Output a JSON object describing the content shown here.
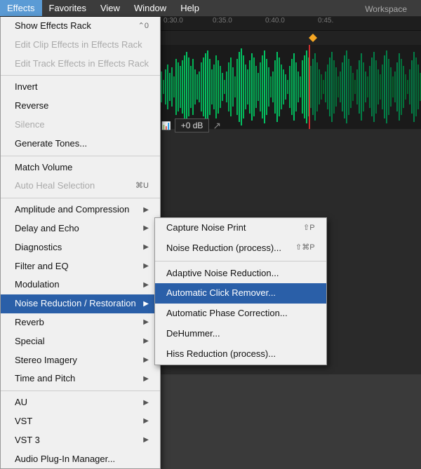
{
  "menubar": {
    "items": [
      {
        "label": "Effects",
        "active": true
      },
      {
        "label": "Favorites"
      },
      {
        "label": "View"
      },
      {
        "label": "Window"
      },
      {
        "label": "Help"
      }
    ]
  },
  "workspace_label": "Workspace",
  "main_menu": {
    "items": [
      {
        "label": "Show Effects Rack",
        "shortcut": "⌃0",
        "type": "normal"
      },
      {
        "label": "Edit Clip Effects in Effects Rack",
        "type": "disabled"
      },
      {
        "label": "Edit Track Effects in Effects Rack",
        "type": "disabled"
      },
      {
        "type": "separator"
      },
      {
        "label": "Invert",
        "type": "normal"
      },
      {
        "label": "Reverse",
        "type": "normal"
      },
      {
        "label": "Silence",
        "type": "disabled"
      },
      {
        "label": "Generate Tones...",
        "type": "normal"
      },
      {
        "type": "separator"
      },
      {
        "label": "Match Volume",
        "type": "normal"
      },
      {
        "label": "Auto Heal Selection",
        "shortcut": "⌘U",
        "type": "disabled"
      },
      {
        "type": "separator"
      },
      {
        "label": "Amplitude and Compression",
        "arrow": true,
        "type": "normal"
      },
      {
        "label": "Delay and Echo",
        "arrow": true,
        "type": "normal"
      },
      {
        "label": "Diagnostics",
        "arrow": true,
        "type": "normal"
      },
      {
        "label": "Filter and EQ",
        "arrow": true,
        "type": "normal"
      },
      {
        "label": "Modulation",
        "arrow": true,
        "type": "normal"
      },
      {
        "label": "Noise Reduction / Restoration",
        "arrow": true,
        "type": "active"
      },
      {
        "label": "Reverb",
        "arrow": true,
        "type": "normal"
      },
      {
        "label": "Special",
        "arrow": true,
        "type": "normal"
      },
      {
        "label": "Stereo Imagery",
        "arrow": true,
        "type": "normal"
      },
      {
        "label": "Time and Pitch",
        "arrow": true,
        "type": "normal"
      },
      {
        "type": "separator"
      },
      {
        "label": "AU",
        "arrow": true,
        "type": "normal"
      },
      {
        "label": "VST",
        "arrow": true,
        "type": "normal"
      },
      {
        "label": "VST 3",
        "arrow": true,
        "type": "normal"
      },
      {
        "label": "Audio Plug-In Manager...",
        "type": "normal"
      }
    ]
  },
  "submenu": {
    "items": [
      {
        "label": "Capture Noise Print",
        "shortcut": "⇧P",
        "type": "normal"
      },
      {
        "label": "Noise Reduction (process)...",
        "shortcut": "⇧⌘P",
        "type": "normal"
      },
      {
        "type": "separator"
      },
      {
        "label": "Adaptive Noise Reduction...",
        "type": "normal"
      },
      {
        "label": "Automatic Click Remover...",
        "type": "highlighted"
      },
      {
        "label": "Automatic Phase Correction...",
        "type": "normal"
      },
      {
        "label": "DeHummer...",
        "type": "normal"
      },
      {
        "label": "Hiss Reduction (process)...",
        "type": "normal"
      }
    ]
  },
  "volume": "+0 dB",
  "timeline_ticks": [
    "0:30.0",
    "0:35.0",
    "0:40.0",
    "0:45."
  ]
}
